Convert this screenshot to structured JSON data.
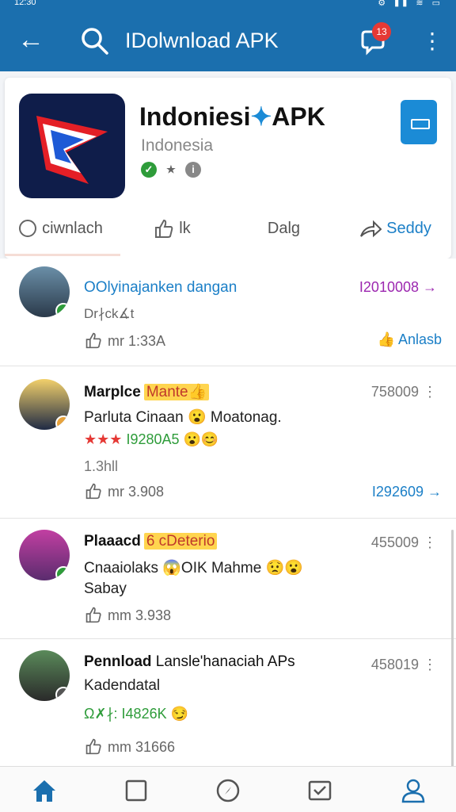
{
  "status_bar": {
    "time": "12:30",
    "icons": "⚙ ▮▮ ≋ ▭"
  },
  "topbar": {
    "title": "IDolwnload APK",
    "badge_count": "13",
    "back_glyph": "←",
    "more_glyph": "⋮"
  },
  "app": {
    "name": "Indoniesi",
    "name_suffix": "APK",
    "region": "Indonesia",
    "verify_marks": [
      "✓",
      "★",
      "i"
    ]
  },
  "actions": [
    {
      "label": "ciwnlach",
      "icon": "download-circle-icon"
    },
    {
      "label": "lk",
      "icon": "thumbs-up-icon"
    },
    {
      "label": "Dalg",
      "icon": "none"
    },
    {
      "label": "Seddy",
      "icon": "share-icon"
    }
  ],
  "posts": [
    {
      "name": "OOlyinajanken dangan",
      "count": "I2010008 →",
      "text": "Dr∤ck∡t",
      "like": "mr 1:33A",
      "link": "Anlasb"
    },
    {
      "name": "Marplce",
      "tag": "Mante👍",
      "count": "758009 ⋮",
      "text": "Parluta Cinaan 😮 Moatonag.",
      "rating": "★★★",
      "rating_text": "I9280A5 😮😊",
      "sub": "1.3hll",
      "like": "mr 3.908",
      "link": "I292609 →"
    },
    {
      "name": "Plaaacd",
      "tag": "6 cDeterio",
      "count": "455009 ⋮",
      "text": "Cnaaiolaks 😱OIK Mahme 😟😮",
      "text2": "Sabay",
      "like": "mm 3.938"
    },
    {
      "name": "Pennload",
      "name_rest": "Lansle'hanaciah APs",
      "count": "458019 ⋮",
      "text": "Kadendatal",
      "meta": "Ω✗∤: I4826K 😏",
      "like": "mm 31666"
    }
  ],
  "colors": {
    "brand": "#1b6fae",
    "accent": "#1b7fc7",
    "link_purple": "#9c27b0",
    "green": "#2e9c3a"
  }
}
